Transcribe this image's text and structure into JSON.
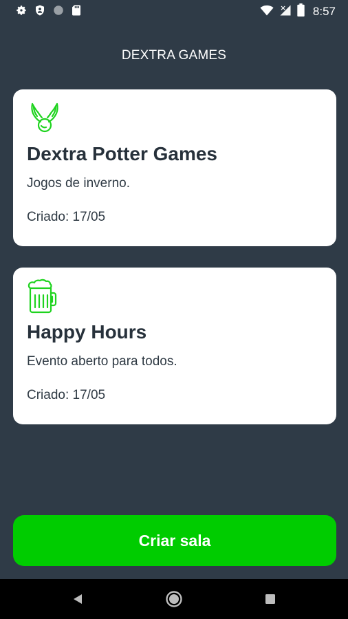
{
  "status_bar": {
    "time": "8:57",
    "left_icons": [
      "gear-icon",
      "shield-icon",
      "circle-icon",
      "sd-card-icon"
    ],
    "right_icons": [
      "wifi-icon",
      "signal-icon",
      "battery-icon"
    ]
  },
  "header": {
    "title": "DEXTRA GAMES"
  },
  "rooms": [
    {
      "icon": "golden-snitch-icon",
      "title": "Dextra Potter Games",
      "description": "Jogos de inverno.",
      "created": "Criado: 17/05"
    },
    {
      "icon": "beer-mug-icon",
      "title": "Happy Hours",
      "description": "Evento aberto para todos.",
      "created": "Criado: 17/05"
    }
  ],
  "actions": {
    "create_room_label": "Criar sala"
  },
  "colors": {
    "background": "#2f3b47",
    "card": "#ffffff",
    "accent": "#00cc00",
    "icon_green": "#1ed31e"
  }
}
